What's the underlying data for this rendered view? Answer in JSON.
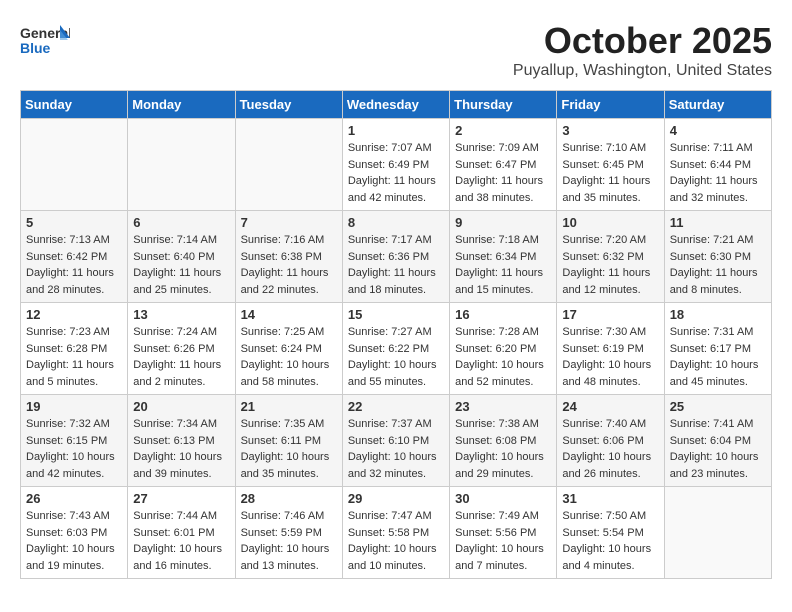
{
  "header": {
    "logo_general": "General",
    "logo_blue": "Blue",
    "month": "October 2025",
    "location": "Puyallup, Washington, United States"
  },
  "days_of_week": [
    "Sunday",
    "Monday",
    "Tuesday",
    "Wednesday",
    "Thursday",
    "Friday",
    "Saturday"
  ],
  "weeks": [
    [
      {
        "day": "",
        "info": ""
      },
      {
        "day": "",
        "info": ""
      },
      {
        "day": "",
        "info": ""
      },
      {
        "day": "1",
        "info": "Sunrise: 7:07 AM\nSunset: 6:49 PM\nDaylight: 11 hours and 42 minutes."
      },
      {
        "day": "2",
        "info": "Sunrise: 7:09 AM\nSunset: 6:47 PM\nDaylight: 11 hours and 38 minutes."
      },
      {
        "day": "3",
        "info": "Sunrise: 7:10 AM\nSunset: 6:45 PM\nDaylight: 11 hours and 35 minutes."
      },
      {
        "day": "4",
        "info": "Sunrise: 7:11 AM\nSunset: 6:44 PM\nDaylight: 11 hours and 32 minutes."
      }
    ],
    [
      {
        "day": "5",
        "info": "Sunrise: 7:13 AM\nSunset: 6:42 PM\nDaylight: 11 hours and 28 minutes."
      },
      {
        "day": "6",
        "info": "Sunrise: 7:14 AM\nSunset: 6:40 PM\nDaylight: 11 hours and 25 minutes."
      },
      {
        "day": "7",
        "info": "Sunrise: 7:16 AM\nSunset: 6:38 PM\nDaylight: 11 hours and 22 minutes."
      },
      {
        "day": "8",
        "info": "Sunrise: 7:17 AM\nSunset: 6:36 PM\nDaylight: 11 hours and 18 minutes."
      },
      {
        "day": "9",
        "info": "Sunrise: 7:18 AM\nSunset: 6:34 PM\nDaylight: 11 hours and 15 minutes."
      },
      {
        "day": "10",
        "info": "Sunrise: 7:20 AM\nSunset: 6:32 PM\nDaylight: 11 hours and 12 minutes."
      },
      {
        "day": "11",
        "info": "Sunrise: 7:21 AM\nSunset: 6:30 PM\nDaylight: 11 hours and 8 minutes."
      }
    ],
    [
      {
        "day": "12",
        "info": "Sunrise: 7:23 AM\nSunset: 6:28 PM\nDaylight: 11 hours and 5 minutes."
      },
      {
        "day": "13",
        "info": "Sunrise: 7:24 AM\nSunset: 6:26 PM\nDaylight: 11 hours and 2 minutes."
      },
      {
        "day": "14",
        "info": "Sunrise: 7:25 AM\nSunset: 6:24 PM\nDaylight: 10 hours and 58 minutes."
      },
      {
        "day": "15",
        "info": "Sunrise: 7:27 AM\nSunset: 6:22 PM\nDaylight: 10 hours and 55 minutes."
      },
      {
        "day": "16",
        "info": "Sunrise: 7:28 AM\nSunset: 6:20 PM\nDaylight: 10 hours and 52 minutes."
      },
      {
        "day": "17",
        "info": "Sunrise: 7:30 AM\nSunset: 6:19 PM\nDaylight: 10 hours and 48 minutes."
      },
      {
        "day": "18",
        "info": "Sunrise: 7:31 AM\nSunset: 6:17 PM\nDaylight: 10 hours and 45 minutes."
      }
    ],
    [
      {
        "day": "19",
        "info": "Sunrise: 7:32 AM\nSunset: 6:15 PM\nDaylight: 10 hours and 42 minutes."
      },
      {
        "day": "20",
        "info": "Sunrise: 7:34 AM\nSunset: 6:13 PM\nDaylight: 10 hours and 39 minutes."
      },
      {
        "day": "21",
        "info": "Sunrise: 7:35 AM\nSunset: 6:11 PM\nDaylight: 10 hours and 35 minutes."
      },
      {
        "day": "22",
        "info": "Sunrise: 7:37 AM\nSunset: 6:10 PM\nDaylight: 10 hours and 32 minutes."
      },
      {
        "day": "23",
        "info": "Sunrise: 7:38 AM\nSunset: 6:08 PM\nDaylight: 10 hours and 29 minutes."
      },
      {
        "day": "24",
        "info": "Sunrise: 7:40 AM\nSunset: 6:06 PM\nDaylight: 10 hours and 26 minutes."
      },
      {
        "day": "25",
        "info": "Sunrise: 7:41 AM\nSunset: 6:04 PM\nDaylight: 10 hours and 23 minutes."
      }
    ],
    [
      {
        "day": "26",
        "info": "Sunrise: 7:43 AM\nSunset: 6:03 PM\nDaylight: 10 hours and 19 minutes."
      },
      {
        "day": "27",
        "info": "Sunrise: 7:44 AM\nSunset: 6:01 PM\nDaylight: 10 hours and 16 minutes."
      },
      {
        "day": "28",
        "info": "Sunrise: 7:46 AM\nSunset: 5:59 PM\nDaylight: 10 hours and 13 minutes."
      },
      {
        "day": "29",
        "info": "Sunrise: 7:47 AM\nSunset: 5:58 PM\nDaylight: 10 hours and 10 minutes."
      },
      {
        "day": "30",
        "info": "Sunrise: 7:49 AM\nSunset: 5:56 PM\nDaylight: 10 hours and 7 minutes."
      },
      {
        "day": "31",
        "info": "Sunrise: 7:50 AM\nSunset: 5:54 PM\nDaylight: 10 hours and 4 minutes."
      },
      {
        "day": "",
        "info": ""
      }
    ]
  ]
}
